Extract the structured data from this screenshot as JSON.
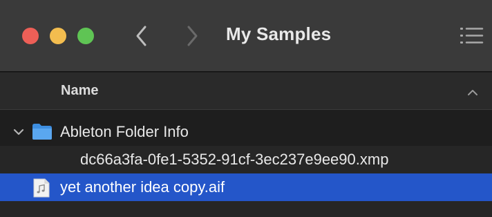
{
  "window": {
    "title": "My Samples",
    "traffic_colors": {
      "close": "#ed5f57",
      "minimize": "#f3bd4f",
      "zoom": "#5fc454"
    }
  },
  "toolbar": {
    "back_icon": "chevron-left-icon",
    "forward_icon": "chevron-right-icon",
    "view_icon": "list-view-icon"
  },
  "columns": {
    "name": "Name",
    "sort_icon": "chevron-up-icon"
  },
  "files": [
    {
      "name": "Ableton Folder Info",
      "kind": "folder",
      "expanded": true,
      "level": 0,
      "selected": false,
      "icon": "folder-icon"
    },
    {
      "name": "dc66a3fa-0fe1-5352-91cf-3ec237e9ee90.xmp",
      "kind": "file",
      "level": 1,
      "selected": false
    },
    {
      "name": "yet another idea copy.aif",
      "kind": "audio-file",
      "level": 0,
      "selected": true,
      "icon": "audio-file-icon"
    }
  ],
  "colors": {
    "selection": "#2456c9",
    "folder": "#4a9ee8"
  }
}
